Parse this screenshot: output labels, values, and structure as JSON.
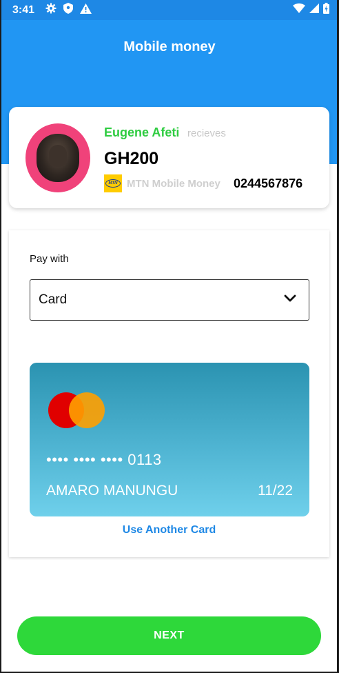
{
  "status_bar": {
    "time": "3:41",
    "left_icons": [
      "gear-icon",
      "shield-icon",
      "alert-icon"
    ],
    "right_icons": [
      "wifi-icon",
      "signal-icon",
      "battery-icon"
    ]
  },
  "header": {
    "title": "Mobile money"
  },
  "recipient": {
    "name": "Eugene Afeti",
    "receives_label": "recieves",
    "amount": "GH200",
    "provider_logo_text": "MTN",
    "provider_name": "MTN Mobile Money",
    "phone": "0244567876"
  },
  "payment": {
    "pay_with_label": "Pay with",
    "method_selected": "Card",
    "card": {
      "number": "•••• •••• •••• 0113",
      "holder": "AMARO MANUNGU",
      "expiry": "11/22",
      "brand": "mastercard"
    },
    "use_another_label": "Use Another Card"
  },
  "next_button": {
    "label": "NEXT"
  },
  "colors": {
    "header": "#2196f3",
    "accent_green": "#2ed83a",
    "name_green": "#2ecc40",
    "link_blue": "#1e88e5",
    "avatar_ring": "#f0427a"
  }
}
